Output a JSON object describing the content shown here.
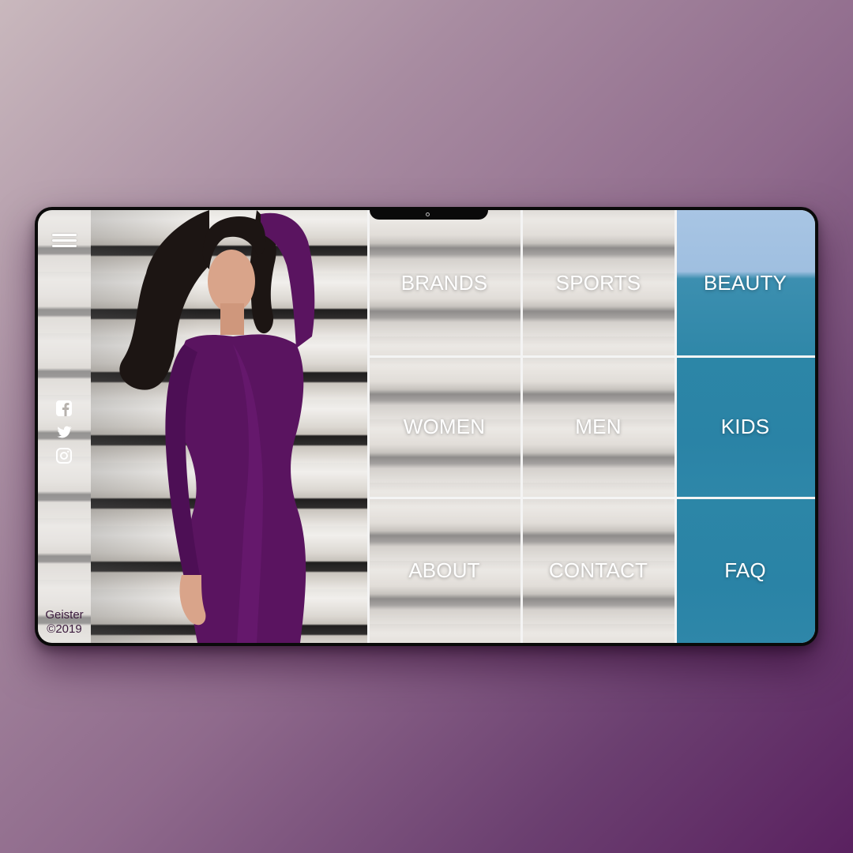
{
  "sidebar": {
    "menu_icon": "hamburger-menu-icon",
    "social": [
      {
        "name": "facebook-icon"
      },
      {
        "name": "twitter-icon"
      },
      {
        "name": "instagram-icon"
      }
    ],
    "brand_name": "Geister",
    "copyright": "©2019"
  },
  "tiles": [
    {
      "label": "BRANDS"
    },
    {
      "label": "SPORTS"
    },
    {
      "label": "BEAUTY"
    },
    {
      "label": "WOMEN"
    },
    {
      "label": "MEN"
    },
    {
      "label": "KIDS"
    },
    {
      "label": "ABOUT"
    },
    {
      "label": "CONTACT"
    },
    {
      "label": "FAQ"
    }
  ],
  "colors": {
    "dress": "#5a1460",
    "sea": "#2c86a7",
    "sky": "#a8c5e4",
    "background_end": "#5a2160"
  }
}
